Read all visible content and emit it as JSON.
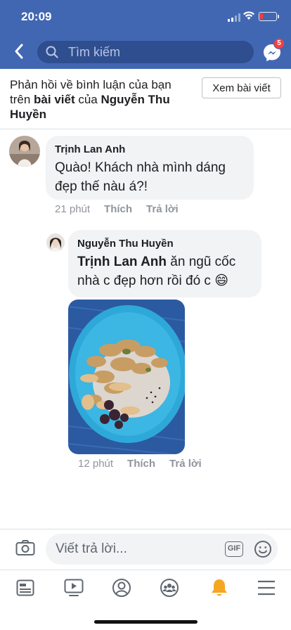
{
  "status_bar": {
    "time": "20:09"
  },
  "header": {
    "search_placeholder": "Tìm kiếm",
    "messenger_badge": "5"
  },
  "context": {
    "text_prefix": "Phản hồi về bình luận của bạn trên ",
    "post_word": "bài viết",
    "text_middle": " của ",
    "post_author": "Nguyễn Thu Huyền",
    "view_post_label": "Xem bài viết"
  },
  "comment": {
    "author": "Trịnh Lan Anh",
    "text": "Quào! Khách nhà mình dáng đẹp thế nàu á?!",
    "time": "21 phút",
    "like_label": "Thích",
    "reply_label": "Trả lời"
  },
  "reply": {
    "author": "Nguyễn Thu Huyền",
    "mention": "Trịnh Lan Anh",
    "text": " ăn ngũ cốc nhà c đẹp hơn rồi đó c 😄",
    "time": "12 phút",
    "like_label": "Thích",
    "reply_label": "Trả lời"
  },
  "composer": {
    "placeholder": "Viết trả lời...",
    "gif_label": "GIF"
  },
  "tabs": [
    "news-feed",
    "watch",
    "profile",
    "groups",
    "notifications",
    "menu"
  ],
  "colors": {
    "brand": "#4267b2",
    "bubble": "#f2f3f5",
    "meta": "#90949c",
    "active_tab": "#f5a623"
  }
}
